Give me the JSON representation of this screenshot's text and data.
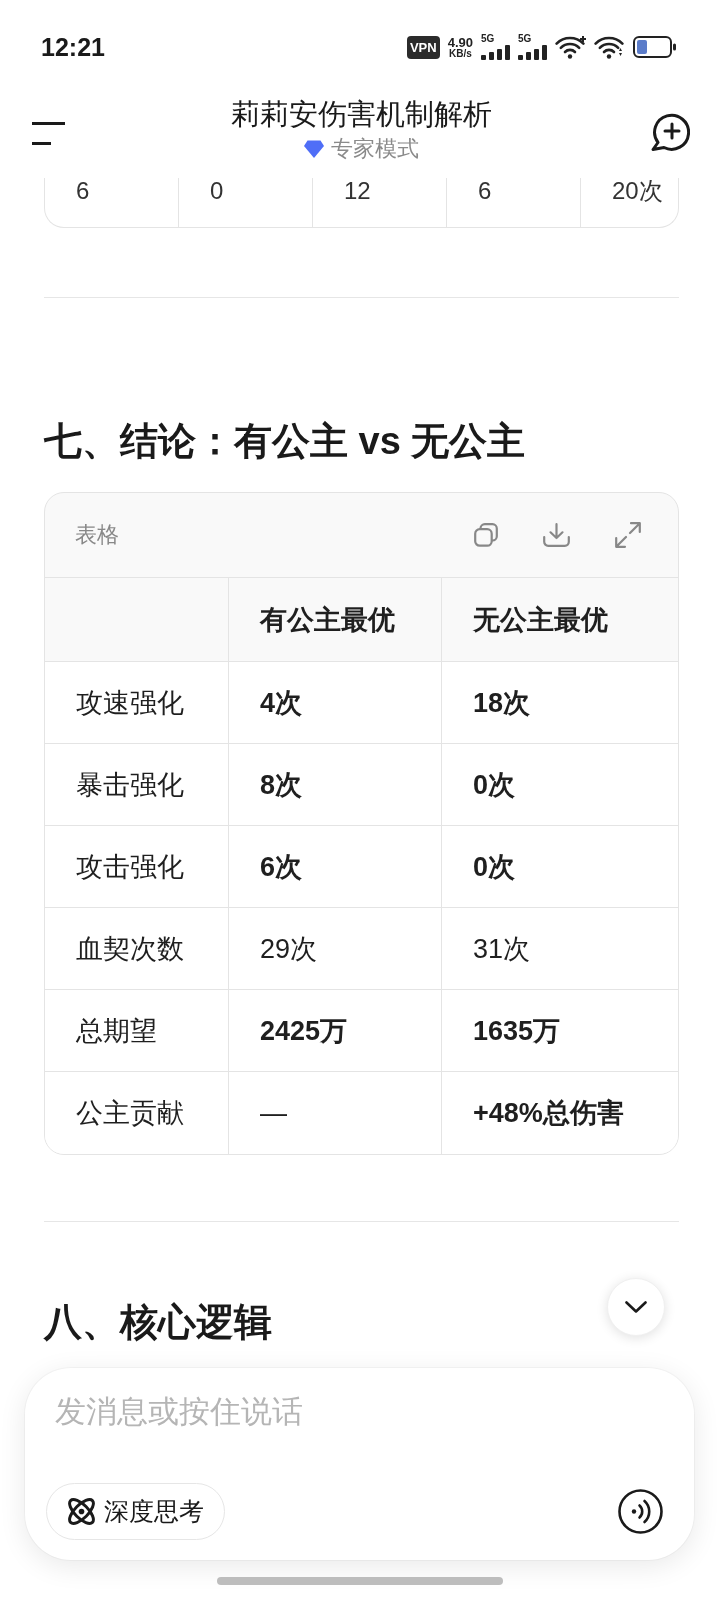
{
  "status_bar": {
    "time": "12:21",
    "vpn": "VPN",
    "speed_value": "4.90",
    "speed_unit": "KB/s",
    "networks": [
      "5G",
      "5G"
    ]
  },
  "header": {
    "title": "莉莉安伤害机制解析",
    "mode": "专家模式"
  },
  "table_above": {
    "row": [
      "6",
      "0",
      "12",
      "6",
      "20次"
    ]
  },
  "sections": [
    {
      "heading": "七、结论：有公主 vs 无公主",
      "table": {
        "label": "表格",
        "columns": [
          "有公主最优",
          "无公主最优"
        ],
        "rows": [
          {
            "label": "攻速强化",
            "cells": [
              {
                "text": "4次",
                "bold": true
              },
              {
                "text": "18次",
                "bold": true
              }
            ]
          },
          {
            "label": "暴击强化",
            "cells": [
              {
                "text": "8次",
                "bold": true
              },
              {
                "text": "0次",
                "bold": true
              }
            ]
          },
          {
            "label": "攻击强化",
            "cells": [
              {
                "text": "6次",
                "bold": true
              },
              {
                "text": "0次",
                "bold": true
              }
            ]
          },
          {
            "label": "血契次数",
            "cells": [
              {
                "text": "29次",
                "bold": false
              },
              {
                "text": "31次",
                "bold": false
              }
            ]
          },
          {
            "label": "总期望",
            "cells": [
              {
                "text": "2425万",
                "bold": true
              },
              {
                "text": "1635万",
                "bold": true
              }
            ]
          },
          {
            "label": "公主贡献",
            "cells": [
              {
                "text": "—",
                "bold": false
              },
              {
                "text": "+48%总伤害",
                "bold": true
              }
            ]
          }
        ]
      }
    },
    {
      "heading": "八、核心逻辑"
    }
  ],
  "composer": {
    "placeholder": "发消息或按住说话",
    "deep_think": {
      "label": "深度思考",
      "on": false
    }
  }
}
